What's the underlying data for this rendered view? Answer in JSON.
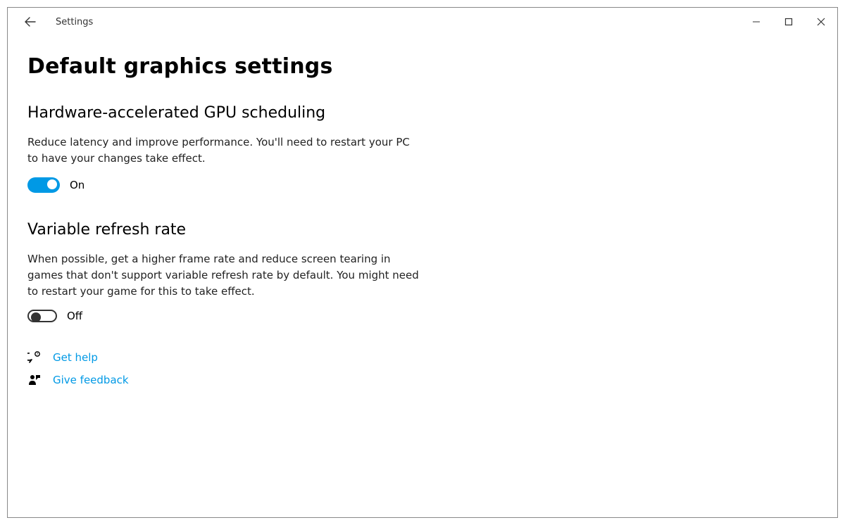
{
  "header": {
    "app_title": "Settings"
  },
  "page": {
    "title": "Default graphics settings"
  },
  "sections": {
    "gpu_scheduling": {
      "title": "Hardware-accelerated GPU scheduling",
      "description": "Reduce latency and improve performance. You'll need to restart your PC to have your changes take effect.",
      "toggle_state_label": "On",
      "toggle_on": true
    },
    "variable_refresh": {
      "title": "Variable refresh rate",
      "description": "When possible, get a higher frame rate and reduce screen tearing in games that don't support variable refresh rate by default. You might need to restart your game for this to take effect.",
      "toggle_state_label": "Off",
      "toggle_on": false
    }
  },
  "links": {
    "get_help": "Get help",
    "give_feedback": "Give feedback"
  },
  "colors": {
    "accent": "#0099e5",
    "text": "#000000",
    "link": "#0099e5"
  }
}
